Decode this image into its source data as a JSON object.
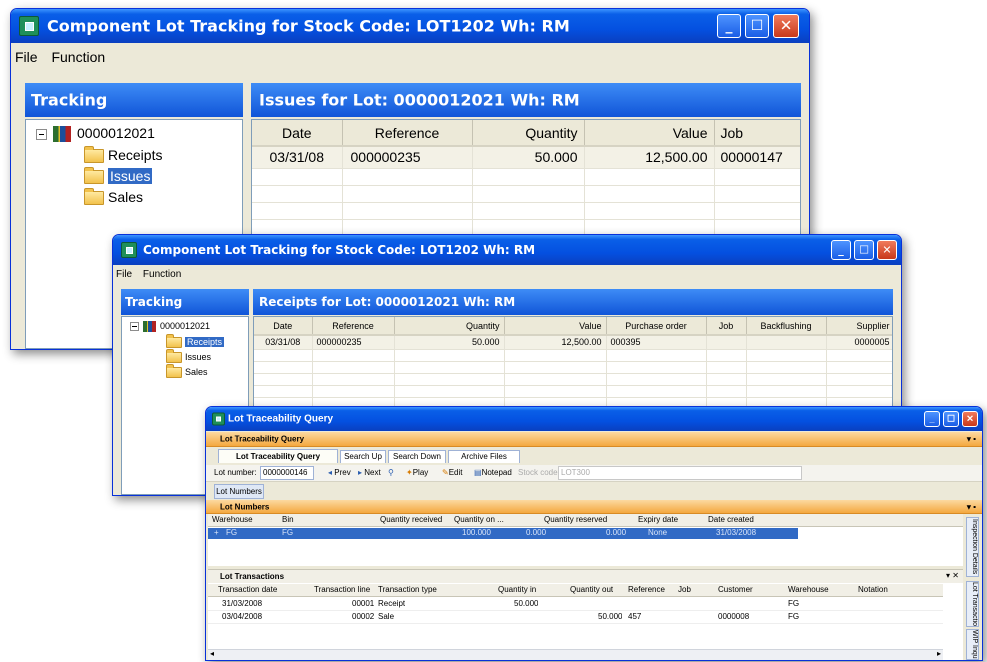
{
  "window1": {
    "title": "Component Lot Tracking for Stock Code: LOT1202 Wh: RM",
    "menu": [
      "File",
      "Function"
    ],
    "tracking_header": "Tracking",
    "panel_title": "Issues for Lot: 0000012021 Wh: RM",
    "tree": {
      "root": "0000012021",
      "children": [
        "Receipts",
        "Issues",
        "Sales"
      ],
      "selected": "Issues"
    },
    "columns": [
      "Date",
      "Reference",
      "Quantity",
      "Value",
      "Job"
    ],
    "rows": [
      [
        "03/31/08",
        "000000235",
        "50.000",
        "12,500.00",
        "00000147"
      ]
    ]
  },
  "window2": {
    "title": "Component Lot Tracking for Stock Code: LOT1202 Wh: RM",
    "menu": [
      "File",
      "Function"
    ],
    "tracking_header": "Tracking",
    "panel_title": "Receipts for Lot: 0000012021 Wh: RM",
    "tree": {
      "root": "0000012021",
      "children": [
        "Receipts",
        "Issues",
        "Sales"
      ],
      "selected": "Receipts"
    },
    "columns": [
      "Date",
      "Reference",
      "Quantity",
      "Value",
      "Purchase order",
      "Job",
      "Backflushing",
      "Supplier"
    ],
    "rows": [
      [
        "03/31/08",
        "000000235",
        "50.000",
        "12,500.00",
        "000395",
        "",
        "",
        "0000005"
      ]
    ]
  },
  "window3": {
    "title": "Lot Traceability Query",
    "section_title": "Lot Traceability Query",
    "tabs": [
      "Lot Traceability Query",
      "Search Up",
      "Search Down",
      "Archive Files"
    ],
    "toolbar": {
      "lot_number_label": "Lot number:",
      "lot_number_value": "0000000146",
      "prev": "Prev",
      "next": "Next",
      "play": "Play",
      "edit": "Edit",
      "notepad": "Notepad",
      "stock_code_label": "Stock code:",
      "stock_code_value": "LOT300"
    },
    "lot_numbers_button": "Lot Numbers",
    "lot_numbers_section": "Lot Numbers",
    "lot_numbers_columns": [
      "Warehouse",
      "Bin",
      "Quantity received",
      "Quantity on ...",
      "Quantity reserved",
      "Expiry date",
      "Date created"
    ],
    "lot_numbers_rows": [
      [
        "FG",
        "FG",
        "100.000",
        "0.000",
        "0.000",
        "None",
        "31/03/2008"
      ]
    ],
    "lot_transactions_section": "Lot Transactions",
    "lot_transactions_columns": [
      "Transaction date",
      "Transaction line",
      "Transaction type",
      "Quantity in",
      "Quantity out",
      "Reference",
      "Job",
      "Customer",
      "Warehouse",
      "Notation"
    ],
    "lot_transactions_rows": [
      [
        "31/03/2008",
        "00001",
        "Receipt",
        "50.000",
        "",
        "",
        "",
        "",
        "FG",
        ""
      ],
      [
        "03/04/2008",
        "00002",
        "Sale",
        "",
        "50.000",
        "457",
        "",
        "0000008",
        "FG",
        ""
      ]
    ],
    "side_tabs": [
      "Inspection Details",
      "Lot Transactions",
      "WIP Inquiry"
    ]
  }
}
